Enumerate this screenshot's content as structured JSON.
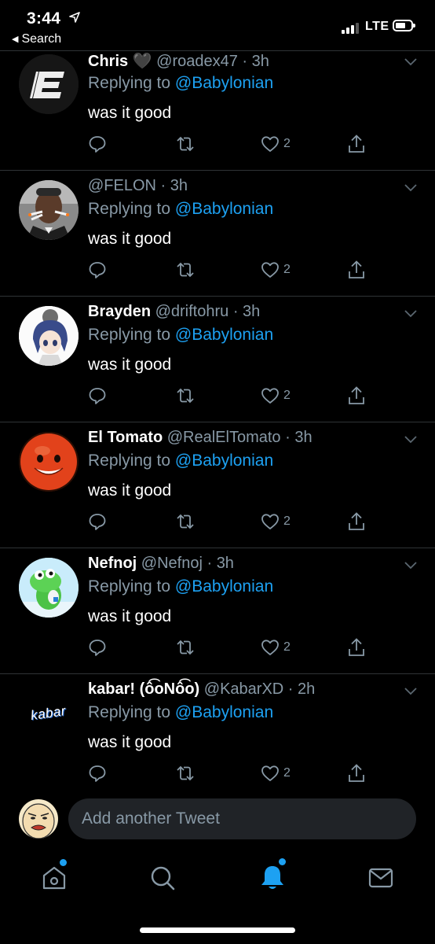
{
  "status": {
    "time": "3:44",
    "back_label": "Search",
    "network": "LTE"
  },
  "tweets": [
    {
      "name": "Chris 🖤",
      "handle": "@roadex47",
      "age": "3h",
      "replying_prefix": "Replying to",
      "mention": "@Babylonian",
      "text": "was it good",
      "likes": "2"
    },
    {
      "name": "",
      "handle": "@FELON",
      "age": "3h",
      "replying_prefix": "Replying to",
      "mention": "@Babylonian",
      "text": "was it good",
      "likes": "2"
    },
    {
      "name": "Brayden",
      "handle": "@driftohru",
      "age": "3h",
      "replying_prefix": "Replying to",
      "mention": "@Babylonian",
      "text": "was it good",
      "likes": "2"
    },
    {
      "name": "El Tomato",
      "handle": "@RealElTomato",
      "age": "3h",
      "replying_prefix": "Replying to",
      "mention": "@Babylonian",
      "text": "was it good",
      "likes": "2"
    },
    {
      "name": "Nefnoj",
      "handle": "@Nefnoj",
      "age": "3h",
      "replying_prefix": "Replying to",
      "mention": "@Babylonian",
      "text": "was it good",
      "likes": "2"
    },
    {
      "name": "kabar! (ô͡oNô͡o)",
      "handle": "@KabarXD",
      "age": "2h",
      "replying_prefix": "Replying to",
      "mention": "@Babylonian",
      "text": "was it good",
      "likes": "2",
      "avatar_text": "kabar"
    }
  ],
  "composer": {
    "placeholder": "Add another Tweet"
  },
  "tabs": [
    "home",
    "search",
    "notifications",
    "messages"
  ],
  "colors": {
    "accent": "#1da1f2",
    "secondary_text": "#8899a6",
    "divider": "#2f3336",
    "background": "#000000"
  }
}
